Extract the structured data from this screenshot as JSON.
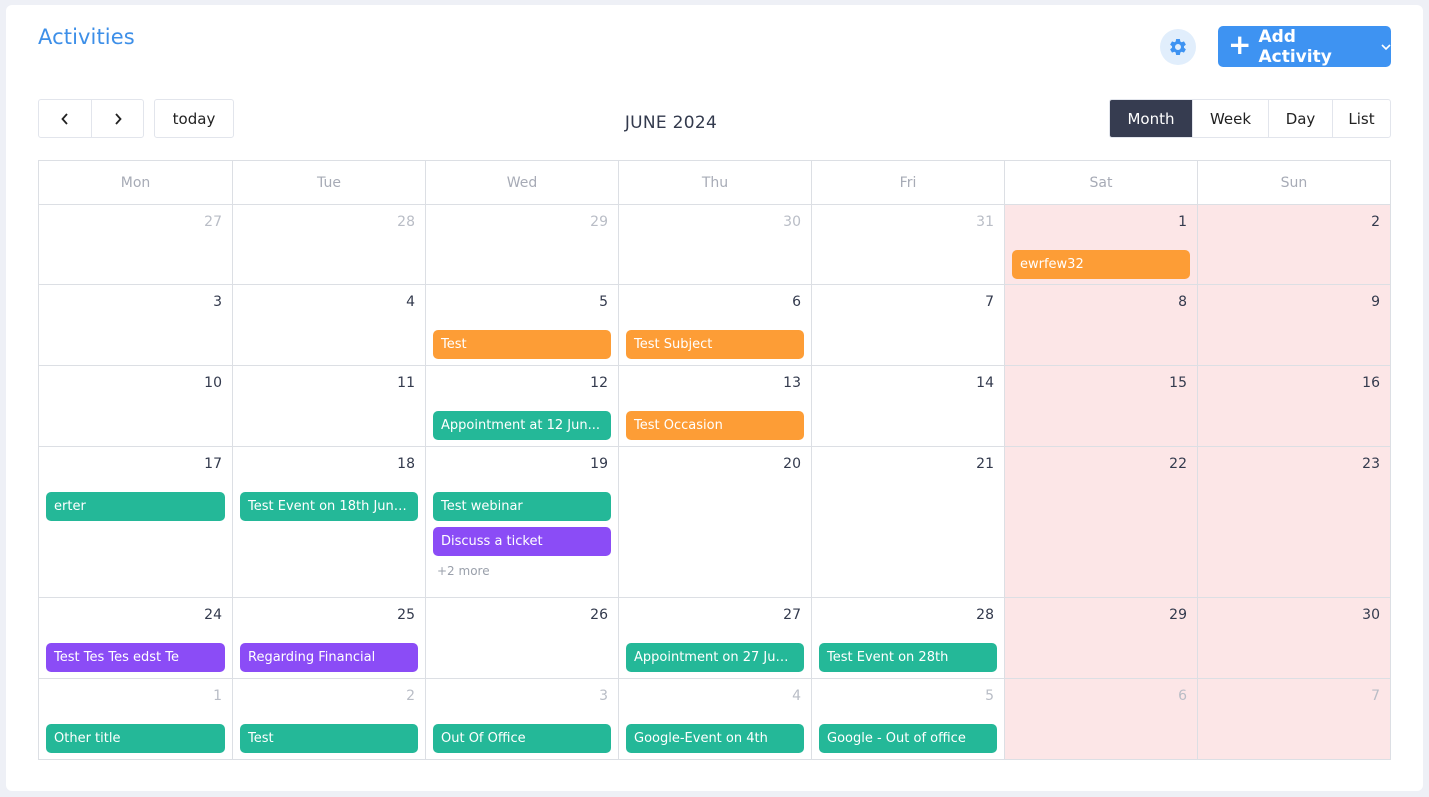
{
  "header": {
    "title": "Activities",
    "settings_icon": "gear-icon",
    "add_button": {
      "label": "Add Activity",
      "icon": "plus-icon"
    }
  },
  "toolbar": {
    "prev": "‹",
    "next": "›",
    "today": "today",
    "month_title": "JUNE 2024",
    "views": [
      "Month",
      "Week",
      "Day",
      "List"
    ],
    "active_view": "Month"
  },
  "colors": {
    "orange": "#fd9d36",
    "green": "#24b898",
    "purple": "#8b4cf6",
    "accent": "#3e93f2",
    "weekend": "#fce6e7"
  },
  "calendar": {
    "weekdays": [
      "Mon",
      "Tue",
      "Wed",
      "Thu",
      "Fri",
      "Sat",
      "Sun"
    ],
    "weeks": [
      {
        "days": [
          {
            "num": "27",
            "other": true,
            "events": []
          },
          {
            "num": "28",
            "other": true,
            "events": []
          },
          {
            "num": "29",
            "other": true,
            "events": []
          },
          {
            "num": "30",
            "other": true,
            "events": []
          },
          {
            "num": "31",
            "other": true,
            "events": []
          },
          {
            "num": "1",
            "other": false,
            "events": [
              {
                "title": "ewrfew32",
                "color": "orange"
              }
            ]
          },
          {
            "num": "2",
            "other": false,
            "events": []
          }
        ]
      },
      {
        "days": [
          {
            "num": "3",
            "other": false,
            "events": []
          },
          {
            "num": "4",
            "other": false,
            "events": []
          },
          {
            "num": "5",
            "other": false,
            "events": [
              {
                "title": "Test",
                "color": "orange"
              }
            ]
          },
          {
            "num": "6",
            "other": false,
            "events": [
              {
                "title": "Test Subject",
                "color": "orange"
              }
            ]
          },
          {
            "num": "7",
            "other": false,
            "events": []
          },
          {
            "num": "8",
            "other": false,
            "events": []
          },
          {
            "num": "9",
            "other": false,
            "events": []
          }
        ]
      },
      {
        "days": [
          {
            "num": "10",
            "other": false,
            "events": []
          },
          {
            "num": "11",
            "other": false,
            "events": []
          },
          {
            "num": "12",
            "other": false,
            "events": [
              {
                "title": "Appointment at 12 Jun...",
                "color": "green"
              }
            ]
          },
          {
            "num": "13",
            "other": false,
            "events": [
              {
                "title": "Test Occasion",
                "color": "orange"
              }
            ]
          },
          {
            "num": "14",
            "other": false,
            "events": []
          },
          {
            "num": "15",
            "other": false,
            "events": []
          },
          {
            "num": "16",
            "other": false,
            "events": []
          }
        ]
      },
      {
        "days": [
          {
            "num": "17",
            "other": false,
            "events": [
              {
                "title": "erter",
                "color": "green"
              }
            ]
          },
          {
            "num": "18",
            "other": false,
            "events": [
              {
                "title": "Test Event on 18th June...",
                "color": "green"
              }
            ]
          },
          {
            "num": "19",
            "other": false,
            "events": [
              {
                "title": "Test webinar",
                "color": "green"
              },
              {
                "title": "Discuss a ticket",
                "color": "purple"
              }
            ],
            "more": "+2 more"
          },
          {
            "num": "20",
            "other": false,
            "events": []
          },
          {
            "num": "21",
            "other": false,
            "events": []
          },
          {
            "num": "22",
            "other": false,
            "events": []
          },
          {
            "num": "23",
            "other": false,
            "events": []
          }
        ]
      },
      {
        "days": [
          {
            "num": "24",
            "other": false,
            "events": [
              {
                "title": "Test Tes Tes edst Te",
                "color": "purple"
              }
            ]
          },
          {
            "num": "25",
            "other": false,
            "events": [
              {
                "title": "Regarding Financial",
                "color": "purple"
              }
            ]
          },
          {
            "num": "26",
            "other": false,
            "events": []
          },
          {
            "num": "27",
            "other": false,
            "events": [
              {
                "title": "Appointment on 27 Jun...",
                "color": "green"
              }
            ]
          },
          {
            "num": "28",
            "other": false,
            "events": [
              {
                "title": "Test Event on 28th",
                "color": "green"
              }
            ]
          },
          {
            "num": "29",
            "other": false,
            "events": []
          },
          {
            "num": "30",
            "other": false,
            "events": []
          }
        ]
      },
      {
        "days": [
          {
            "num": "1",
            "other": true,
            "events": [
              {
                "title": "Other title",
                "color": "green"
              }
            ]
          },
          {
            "num": "2",
            "other": true,
            "events": [
              {
                "title": "Test",
                "color": "green"
              }
            ]
          },
          {
            "num": "3",
            "other": true,
            "events": [
              {
                "title": "Out Of Office",
                "color": "green"
              }
            ]
          },
          {
            "num": "4",
            "other": true,
            "events": [
              {
                "title": "Google-Event on 4th",
                "color": "green"
              }
            ]
          },
          {
            "num": "5",
            "other": true,
            "events": [
              {
                "title": "Google - Out of office",
                "color": "green"
              }
            ]
          },
          {
            "num": "6",
            "other": true,
            "events": []
          },
          {
            "num": "7",
            "other": true,
            "events": []
          }
        ]
      }
    ]
  }
}
